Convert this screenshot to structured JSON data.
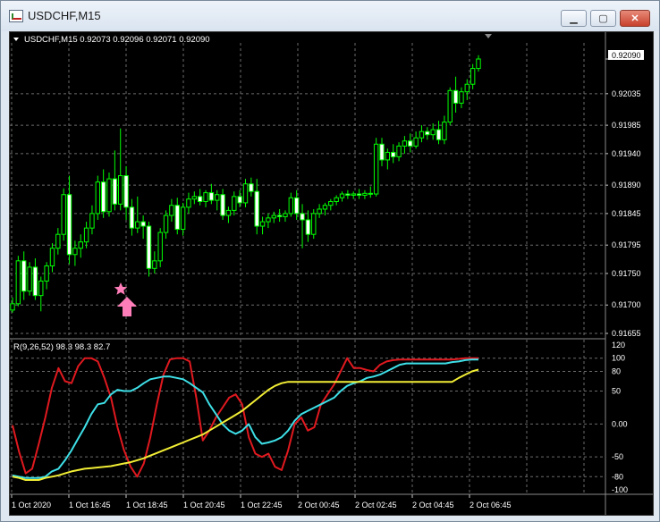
{
  "window": {
    "title": "USDCHF,M15",
    "controls": {
      "minimize_glyph": "▁",
      "maximize_glyph": "▢",
      "close_glyph": "✕"
    }
  },
  "chart": {
    "header": "USDCHF,M15  0.92073 0.92096 0.92071 0.92090",
    "current_price_label": "0.92090",
    "indicator_label": "R(9,26,52) 98.3 98.3 82.7",
    "colors": {
      "background": "#000000",
      "grid": "#6c6c6c",
      "candle": "#00ff00",
      "rsi_fast": "#e0191f",
      "rsi_mid": "#3ee0e8",
      "rsi_slow": "#f2ee35",
      "marker": "#ff7eb9",
      "text": "#ffffff"
    },
    "marker_icons": [
      "star-icon",
      "up-arrow-icon"
    ]
  },
  "chart_data": [
    {
      "type": "candlestick",
      "title": "USDCHF,M15",
      "y_ticks": [
        "0.92090",
        "0.92035",
        "0.91985",
        "0.91940",
        "0.91890",
        "0.91845",
        "0.91795",
        "0.91750",
        "0.91700",
        "0.91655"
      ],
      "ylim": [
        0.91655,
        0.9209
      ],
      "x_ticks": [
        "1 Oct 2020",
        "1 Oct 16:45",
        "1 Oct 18:45",
        "1 Oct 20:45",
        "1 Oct 22:45",
        "2 Oct 00:45",
        "2 Oct 02:45",
        "2 Oct 04:45",
        "2 Oct 06:45"
      ],
      "last_close": 0.9209,
      "candles": [
        [
          0.91692,
          0.91712,
          0.91688,
          0.91702
        ],
        [
          0.91702,
          0.91778,
          0.91698,
          0.9177
        ],
        [
          0.9177,
          0.91785,
          0.91708,
          0.91722
        ],
        [
          0.91722,
          0.91768,
          0.91715,
          0.9176
        ],
        [
          0.9176,
          0.91774,
          0.91708,
          0.91715
        ],
        [
          0.91715,
          0.91745,
          0.9169,
          0.91738
        ],
        [
          0.91738,
          0.91768,
          0.91725,
          0.91762
        ],
        [
          0.91762,
          0.91798,
          0.91752,
          0.9179
        ],
        [
          0.9179,
          0.91822,
          0.9178,
          0.91812
        ],
        [
          0.91812,
          0.91885,
          0.91802,
          0.91875
        ],
        [
          0.91875,
          0.91905,
          0.91765,
          0.9178
        ],
        [
          0.9178,
          0.91802,
          0.91762,
          0.9179
        ],
        [
          0.9179,
          0.91812,
          0.91775,
          0.918
        ],
        [
          0.918,
          0.91832,
          0.9179,
          0.91822
        ],
        [
          0.91822,
          0.91858,
          0.91812,
          0.91845
        ],
        [
          0.91845,
          0.91905,
          0.91835,
          0.91895
        ],
        [
          0.91895,
          0.91915,
          0.91838,
          0.91848
        ],
        [
          0.91848,
          0.9191,
          0.9184,
          0.919
        ],
        [
          0.919,
          0.91945,
          0.9185,
          0.9186
        ],
        [
          0.9186,
          0.9198,
          0.9185,
          0.91905
        ],
        [
          0.91905,
          0.9192,
          0.91835,
          0.91855
        ],
        [
          0.91855,
          0.91868,
          0.9181,
          0.91822
        ],
        [
          0.91822,
          0.91872,
          0.91814,
          0.91832
        ],
        [
          0.91832,
          0.91842,
          0.91805,
          0.91825
        ],
        [
          0.91825,
          0.91832,
          0.91745,
          0.91758
        ],
        [
          0.91758,
          0.91785,
          0.9175,
          0.9177
        ],
        [
          0.9177,
          0.91822,
          0.9176,
          0.91815
        ],
        [
          0.91815,
          0.9185,
          0.91805,
          0.91842
        ],
        [
          0.91842,
          0.91868,
          0.91832,
          0.91858
        ],
        [
          0.91858,
          0.9187,
          0.91812,
          0.9182
        ],
        [
          0.9182,
          0.91862,
          0.9181,
          0.91855
        ],
        [
          0.91855,
          0.91878,
          0.91845,
          0.91868
        ],
        [
          0.91868,
          0.9188,
          0.9186,
          0.91872
        ],
        [
          0.91872,
          0.91884,
          0.91858,
          0.91864
        ],
        [
          0.91864,
          0.91882,
          0.91855,
          0.91878
        ],
        [
          0.91878,
          0.91892,
          0.9186,
          0.91866
        ],
        [
          0.91866,
          0.91882,
          0.9185,
          0.91875
        ],
        [
          0.91875,
          0.91884,
          0.91835,
          0.91842
        ],
        [
          0.91842,
          0.91856,
          0.9183,
          0.9185
        ],
        [
          0.9185,
          0.9188,
          0.91842,
          0.91872
        ],
        [
          0.91872,
          0.91882,
          0.91855,
          0.91862
        ],
        [
          0.91862,
          0.919,
          0.91855,
          0.91892
        ],
        [
          0.91892,
          0.91902,
          0.91872,
          0.9188
        ],
        [
          0.9188,
          0.919,
          0.91812,
          0.91825
        ],
        [
          0.91825,
          0.9184,
          0.91812,
          0.91832
        ],
        [
          0.91832,
          0.91845,
          0.91822,
          0.91838
        ],
        [
          0.91838,
          0.91848,
          0.9183,
          0.91842
        ],
        [
          0.91842,
          0.91852,
          0.91832,
          0.9184
        ],
        [
          0.9184,
          0.9185,
          0.91832,
          0.91845
        ],
        [
          0.91845,
          0.91878,
          0.9184,
          0.9187
        ],
        [
          0.9187,
          0.91882,
          0.91835,
          0.91845
        ],
        [
          0.91845,
          0.9186,
          0.9179,
          0.91835
        ],
        [
          0.91835,
          0.9185,
          0.918,
          0.91812
        ],
        [
          0.91812,
          0.91852,
          0.91805,
          0.91845
        ],
        [
          0.91845,
          0.9186,
          0.91838,
          0.91852
        ],
        [
          0.91852,
          0.91862,
          0.91842,
          0.91858
        ],
        [
          0.91858,
          0.91868,
          0.9185,
          0.91864
        ],
        [
          0.91864,
          0.91874,
          0.91858,
          0.9187
        ],
        [
          0.9187,
          0.9188,
          0.91864,
          0.91876
        ],
        [
          0.91876,
          0.91882,
          0.91868,
          0.91874
        ],
        [
          0.91874,
          0.9188,
          0.91868,
          0.91876
        ],
        [
          0.91876,
          0.91884,
          0.91868,
          0.91874
        ],
        [
          0.91874,
          0.91882,
          0.91868,
          0.91877
        ],
        [
          0.91877,
          0.91888,
          0.9187,
          0.91876
        ],
        [
          0.91876,
          0.91965,
          0.91872,
          0.91955
        ],
        [
          0.91955,
          0.91965,
          0.9192,
          0.9193
        ],
        [
          0.9193,
          0.91948,
          0.91915,
          0.91942
        ],
        [
          0.91942,
          0.91955,
          0.91925,
          0.91935
        ],
        [
          0.91935,
          0.91958,
          0.91928,
          0.91952
        ],
        [
          0.91952,
          0.91968,
          0.9194,
          0.9196
        ],
        [
          0.9196,
          0.91972,
          0.91942,
          0.91952
        ],
        [
          0.91952,
          0.91975,
          0.91948,
          0.91965
        ],
        [
          0.91965,
          0.91985,
          0.91958,
          0.91975
        ],
        [
          0.91975,
          0.91982,
          0.91962,
          0.9197
        ],
        [
          0.9197,
          0.91988,
          0.91962,
          0.91978
        ],
        [
          0.91978,
          0.91992,
          0.91955,
          0.91962
        ],
        [
          0.91962,
          0.92,
          0.91955,
          0.9199
        ],
        [
          0.9199,
          0.92045,
          0.91985,
          0.9204
        ],
        [
          0.9204,
          0.92062,
          0.92005,
          0.9202
        ],
        [
          0.9202,
          0.92045,
          0.92012,
          0.92038
        ],
        [
          0.92038,
          0.92058,
          0.92025,
          0.9205
        ],
        [
          0.9205,
          0.92082,
          0.92042,
          0.92075
        ],
        [
          0.92075,
          0.92096,
          0.9207,
          0.9209
        ]
      ]
    },
    {
      "type": "line",
      "title": "R(9,26,52) 98.3 98.3 82.7",
      "y_ticks": [
        "120",
        "100",
        "80",
        "50",
        "0.00",
        "-50",
        "-80",
        "-100"
      ],
      "ylim": [
        -100,
        120
      ],
      "series": [
        {
          "color": "#e0191f",
          "values": [
            -2,
            -42,
            -75,
            -68,
            -30,
            10,
            55,
            85,
            65,
            62,
            88,
            100,
            100,
            95,
            70,
            40,
            -5,
            -40,
            -65,
            -80,
            -60,
            -20,
            30,
            75,
            98,
            100,
            100,
            95,
            40,
            -25,
            -10,
            10,
            25,
            40,
            45,
            30,
            -20,
            -45,
            -50,
            -45,
            -65,
            -70,
            -40,
            0,
            10,
            -10,
            -5,
            30,
            45,
            60,
            80,
            100,
            85,
            85,
            82,
            80,
            90,
            95,
            97,
            98,
            98,
            98,
            98,
            98,
            98,
            98,
            98,
            98,
            99,
            100,
            100,
            100
          ]
        },
        {
          "color": "#3ee0e8",
          "values": [
            -78,
            -80,
            -82,
            -82,
            -82,
            -80,
            -72,
            -68,
            -55,
            -40,
            -22,
            -5,
            15,
            30,
            32,
            45,
            52,
            50,
            50,
            55,
            62,
            68,
            70,
            72,
            72,
            70,
            68,
            62,
            55,
            48,
            30,
            15,
            0,
            -10,
            -15,
            -10,
            0,
            -20,
            -30,
            -28,
            -25,
            -20,
            -10,
            5,
            15,
            20,
            25,
            30,
            35,
            40,
            50,
            58,
            62,
            65,
            70,
            72,
            75,
            80,
            85,
            90,
            92,
            92,
            92,
            92,
            92,
            92,
            92,
            94,
            95,
            97,
            98,
            98
          ]
        },
        {
          "color": "#f2ee35",
          "values": [
            -80,
            -82,
            -85,
            -85,
            -85,
            -82,
            -80,
            -78,
            -75,
            -72,
            -70,
            -68,
            -67,
            -66,
            -65,
            -64,
            -62,
            -60,
            -58,
            -55,
            -52,
            -48,
            -44,
            -40,
            -36,
            -32,
            -28,
            -24,
            -20,
            -16,
            -10,
            -4,
            2,
            8,
            14,
            20,
            28,
            36,
            44,
            52,
            58,
            62,
            64,
            64,
            64,
            64,
            64,
            64,
            64,
            64,
            64,
            64,
            64,
            64,
            64,
            64,
            64,
            64,
            64,
            64,
            64,
            64,
            64,
            64,
            64,
            64,
            64,
            64,
            70,
            75,
            80,
            82.7
          ]
        }
      ]
    }
  ]
}
